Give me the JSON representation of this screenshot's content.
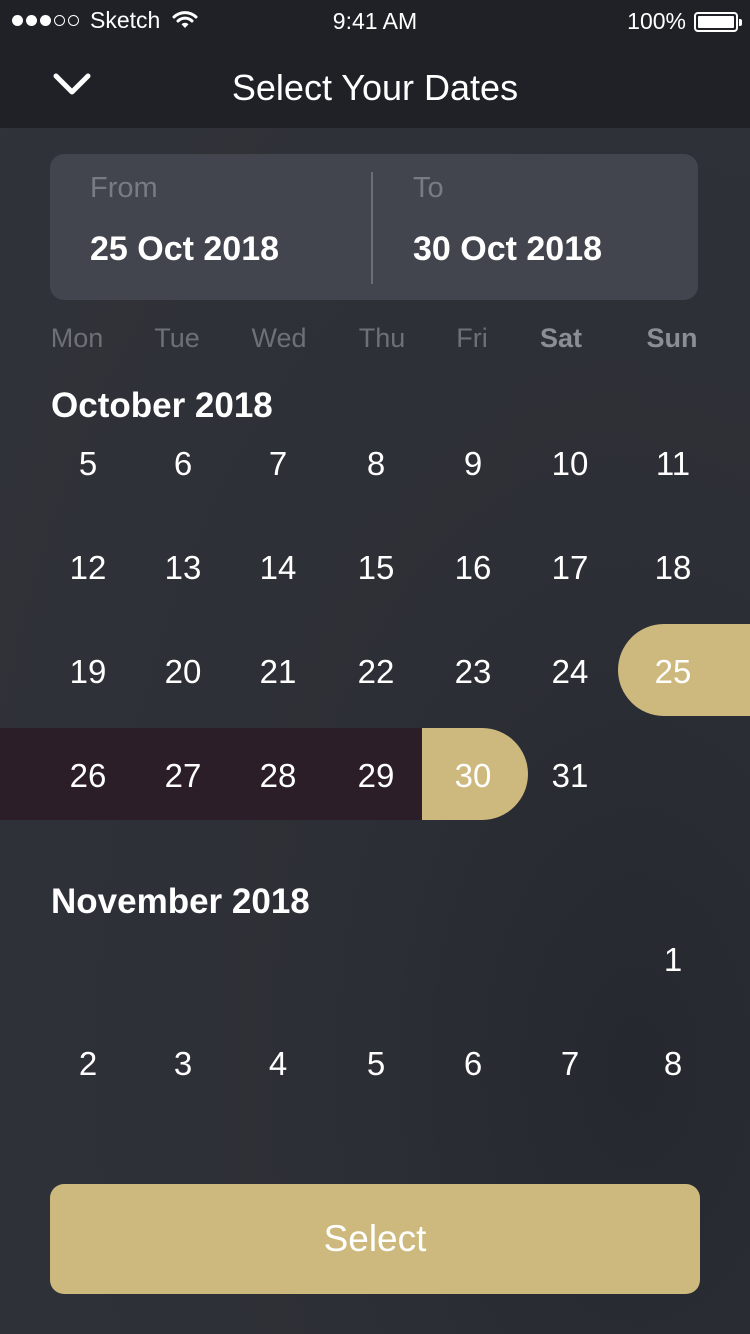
{
  "status_bar": {
    "carrier": "Sketch",
    "time": "9:41 AM",
    "battery": "100%",
    "signal_bars_filled": 3,
    "signal_bars_total": 5,
    "icons": [
      "signal-dots-icon",
      "wifi-icon",
      "battery-icon"
    ]
  },
  "nav": {
    "title": "Select Your Dates",
    "back_icon": "chevron-down-icon"
  },
  "range": {
    "from_label": "From",
    "from_value": "25 Oct 2018",
    "to_label": "To",
    "to_value": "30 Oct 2018"
  },
  "weekdays": [
    "Mon",
    "Tue",
    "Wed",
    "Thu",
    "Fri",
    "Sat",
    "Sun"
  ],
  "months": [
    {
      "title": "October 2018",
      "rows": [
        [
          "5",
          "6",
          "7",
          "8",
          "9",
          "10",
          "11"
        ],
        [
          "12",
          "13",
          "14",
          "15",
          "16",
          "17",
          "18"
        ],
        [
          "19",
          "20",
          "21",
          "22",
          "23",
          "24",
          "25"
        ],
        [
          "26",
          "27",
          "28",
          "29",
          "30",
          "31"
        ]
      ]
    },
    {
      "title": "November 2018",
      "rows": [
        [
          "1"
        ],
        [
          "2",
          "3",
          "4",
          "5",
          "6",
          "7",
          "8"
        ]
      ]
    }
  ],
  "selection": {
    "start_day": "25",
    "end_day": "30",
    "highlight_color": "#cdb97d",
    "range_color": "#2b1e29"
  },
  "select_button": {
    "label": "Select"
  }
}
